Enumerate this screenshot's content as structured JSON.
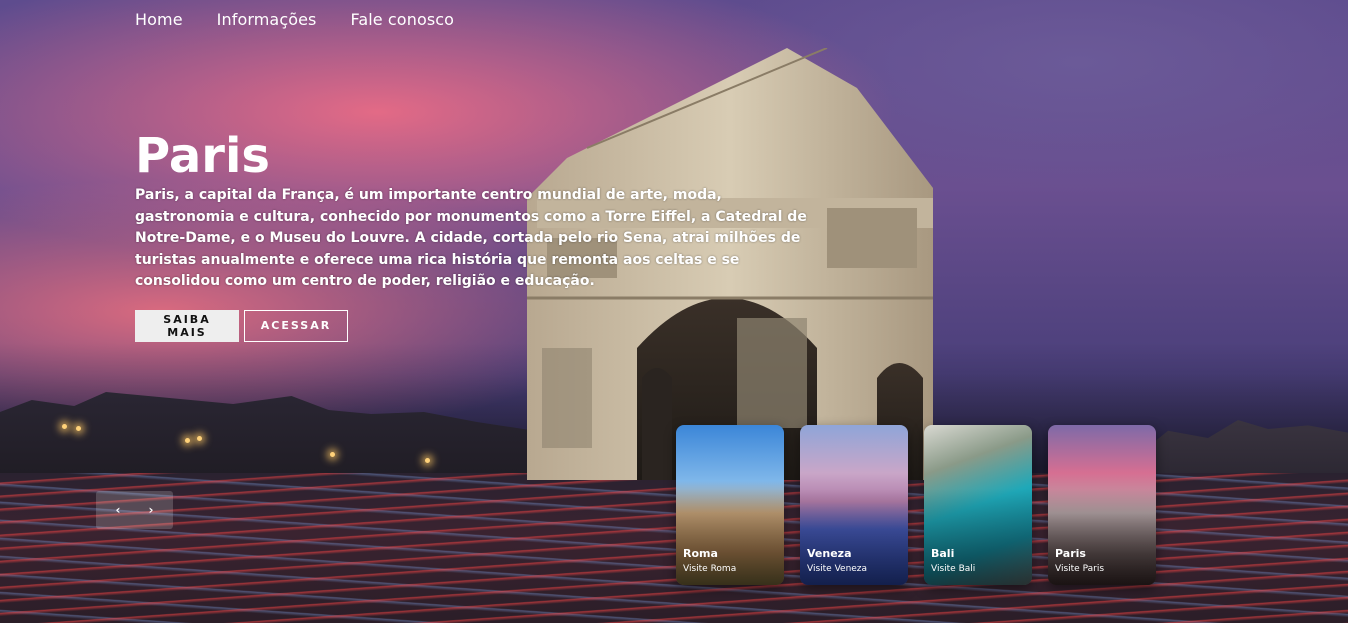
{
  "nav": {
    "items": [
      "Home",
      "Informações",
      "Fale conosco"
    ]
  },
  "hero": {
    "title": "Paris",
    "description": "Paris, a capital da França, é um importante centro mundial de arte, moda, gastronomia e cultura, conhecido por monumentos como a Torre Eiffel, a Catedral de Notre-Dame, e o Museu do Louvre. A cidade, cortada pelo rio Sena, atrai milhões de turistas anualmente e oferece uma rica história que remonta aos celtas e se consolidou como um centro de poder, religião e educação.",
    "primary_button": "SAIBA MAIS",
    "secondary_button": "ACESSAR"
  },
  "slider": {
    "prev_icon": "chevron-left-icon",
    "next_icon": "chevron-right-icon",
    "prev_glyph": "‹",
    "next_glyph": "›"
  },
  "cards": [
    {
      "name": "Roma",
      "subtitle": "Visite Roma"
    },
    {
      "name": "Veneza",
      "subtitle": "Visite Veneza"
    },
    {
      "name": "Bali",
      "subtitle": "Visite Bali"
    },
    {
      "name": "Paris",
      "subtitle": "Visite Paris"
    }
  ]
}
